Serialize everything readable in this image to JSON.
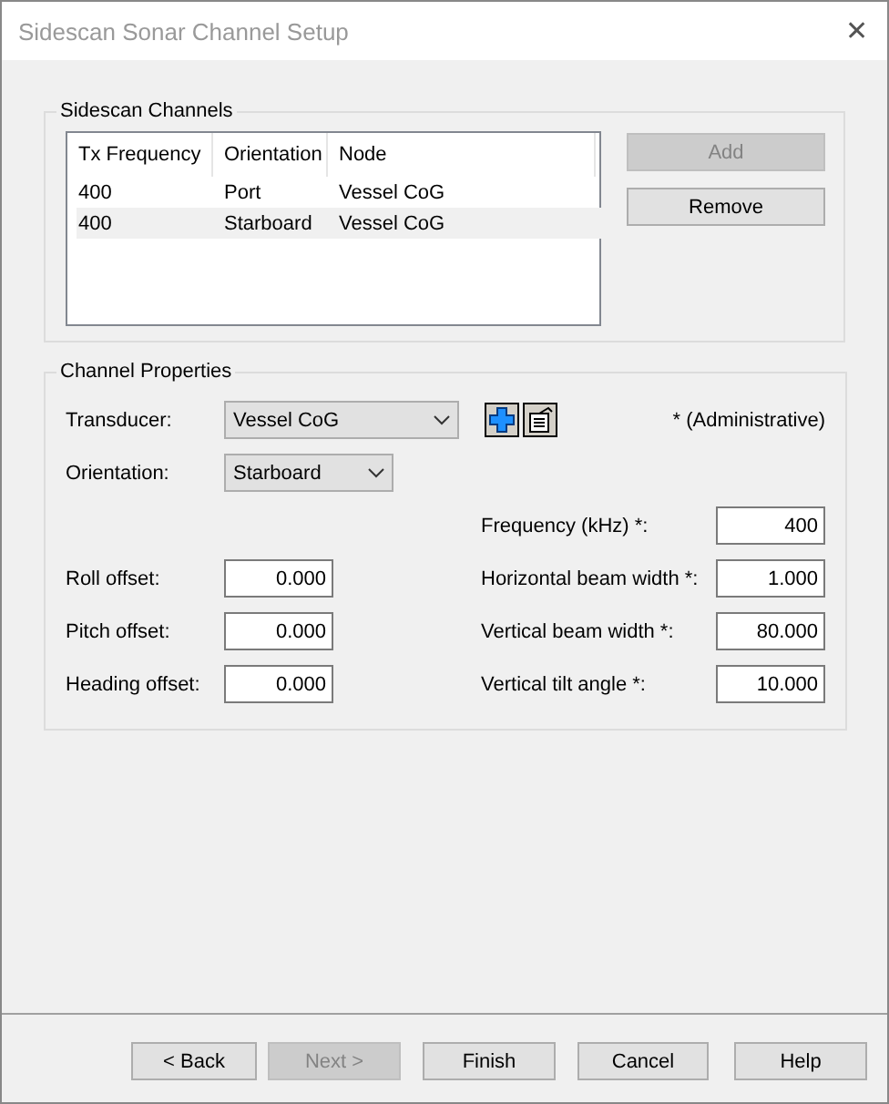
{
  "window": {
    "title": "Sidescan Sonar Channel Setup",
    "close": "✕"
  },
  "channels_group": {
    "title": "Sidescan Channels",
    "columns": [
      "Tx Frequency",
      "Orientation",
      "Node"
    ],
    "rows": [
      {
        "cells": [
          "400",
          "Port",
          "Vessel CoG"
        ],
        "selected": false
      },
      {
        "cells": [
          "400",
          "Starboard",
          "Vessel CoG"
        ],
        "selected": true
      }
    ],
    "buttons": [
      {
        "label": "Add",
        "disabled": true
      },
      {
        "label": "Remove",
        "disabled": false
      }
    ]
  },
  "properties_group": {
    "title": "Channel Properties",
    "transducer": {
      "label": "Transducer:",
      "value": "Vessel CoG"
    },
    "note": "* (Administrative)",
    "orientation": {
      "label": "Orientation:",
      "value": "Starboard"
    },
    "left_fields": [
      {
        "label": "Roll offset:",
        "value": "0.000"
      },
      {
        "label": "Pitch offset:",
        "value": "0.000"
      },
      {
        "label": "Heading offset:",
        "value": "0.000"
      }
    ],
    "right_fields": [
      {
        "label": "Frequency (kHz) *:",
        "value": "400"
      },
      {
        "label": "Horizontal beam width *:",
        "value": "1.000"
      },
      {
        "label": "Vertical beam width *:",
        "value": "80.000"
      },
      {
        "label": "Vertical tilt angle *:",
        "value": "10.000"
      }
    ]
  },
  "footer_buttons": [
    {
      "label": "< Back",
      "disabled": false
    },
    {
      "label": "Next >",
      "disabled": true
    },
    {
      "label": "Finish",
      "disabled": false
    },
    {
      "label": "Cancel",
      "disabled": false
    },
    {
      "label": "Help",
      "disabled": false
    }
  ]
}
